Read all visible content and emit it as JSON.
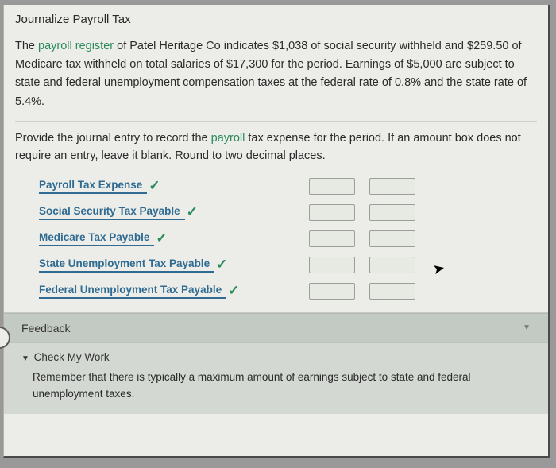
{
  "title": "Journalize Payroll Tax",
  "problem_parts": {
    "p1a": "The ",
    "p1_link": "payroll register",
    "p1b": " of Patel Heritage Co indicates $1,038 of social security withheld and $259.50 of Medicare tax withheld on total salaries of $17,300 for the period. Earnings of $5,000 are subject to state and federal unemployment compensation taxes at the federal rate of 0.8% and the state rate of 5.4%."
  },
  "instructions": {
    "a": "Provide the journal entry to record the ",
    "link": "payroll",
    "b": " tax expense for the period. If an amount box does not require an entry, leave it blank. Round to two decimal places."
  },
  "accounts": [
    {
      "label": "Payroll Tax Expense"
    },
    {
      "label": "Social Security Tax Payable"
    },
    {
      "label": "Medicare Tax Payable"
    },
    {
      "label": "State Unemployment Tax Payable"
    },
    {
      "label": "Federal Unemployment Tax Payable"
    }
  ],
  "feedback_label": "Feedback",
  "check_my_work": "Check My Work",
  "hint_text": "Remember that there is typically a maximum amount of earnings subject to state and federal unemployment taxes."
}
